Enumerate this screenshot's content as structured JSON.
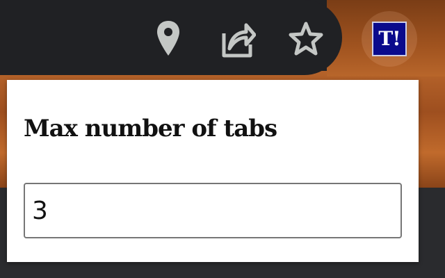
{
  "toolbar": {
    "icons": [
      {
        "name": "location-pin-icon"
      },
      {
        "name": "share-icon"
      },
      {
        "name": "bookmark-star-icon"
      }
    ],
    "extension": {
      "label": "T!",
      "color": "#0a0a8c"
    }
  },
  "popup": {
    "title": "Max number of tabs",
    "input_value": "3"
  },
  "colors": {
    "toolbar": "#202124",
    "accent_orange": "#b5632a",
    "icon": "#c4c7c5"
  }
}
